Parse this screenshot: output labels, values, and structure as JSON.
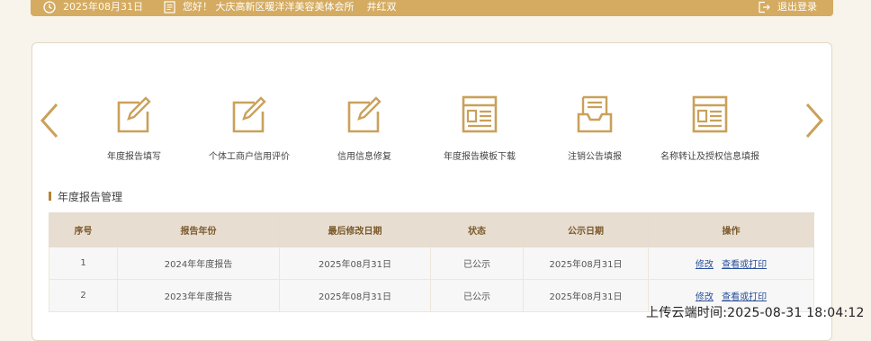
{
  "topbar": {
    "date": "2025年08月31日",
    "greeting": "您好！ 大庆高新区暖洋洋美容美体会所",
    "user": "井红双",
    "logout": "退出登录"
  },
  "nav": {
    "prev_icon": "chevron-left-icon",
    "next_icon": "chevron-right-icon"
  },
  "functions": [
    {
      "label": "年度报告填写",
      "icon": "edit-icon"
    },
    {
      "label": "个体工商户信用评价",
      "icon": "edit-icon"
    },
    {
      "label": "信用信息修复",
      "icon": "edit-icon"
    },
    {
      "label": "年度报告模板下载",
      "icon": "document-template-icon"
    },
    {
      "label": "注销公告填报",
      "icon": "inbox-icon"
    },
    {
      "label": "名称转让及授权信息填报",
      "icon": "document-template-icon"
    }
  ],
  "section": {
    "title": "年度报告管理"
  },
  "table": {
    "headers": [
      "序号",
      "报告年份",
      "最后修改日期",
      "状态",
      "公示日期",
      "操作"
    ],
    "rows": [
      {
        "no": "1",
        "year": "2024年年度报告",
        "modified": "2025年08月31日",
        "status": "已公示",
        "published": "2025年08月31日",
        "edit": "修改",
        "view": "查看或打印"
      },
      {
        "no": "2",
        "year": "2023年年度报告",
        "modified": "2025年08月31日",
        "status": "已公示",
        "published": "2025年08月31日",
        "edit": "修改",
        "view": "查看或打印"
      }
    ]
  },
  "watermark": "上传云端时间:2025-08-31 18:04:12",
  "colors": {
    "gold": "#d4ab60",
    "icon_gold": "#caa15a",
    "link": "#2a4f9a",
    "header_bg": "#e8ddd1"
  }
}
